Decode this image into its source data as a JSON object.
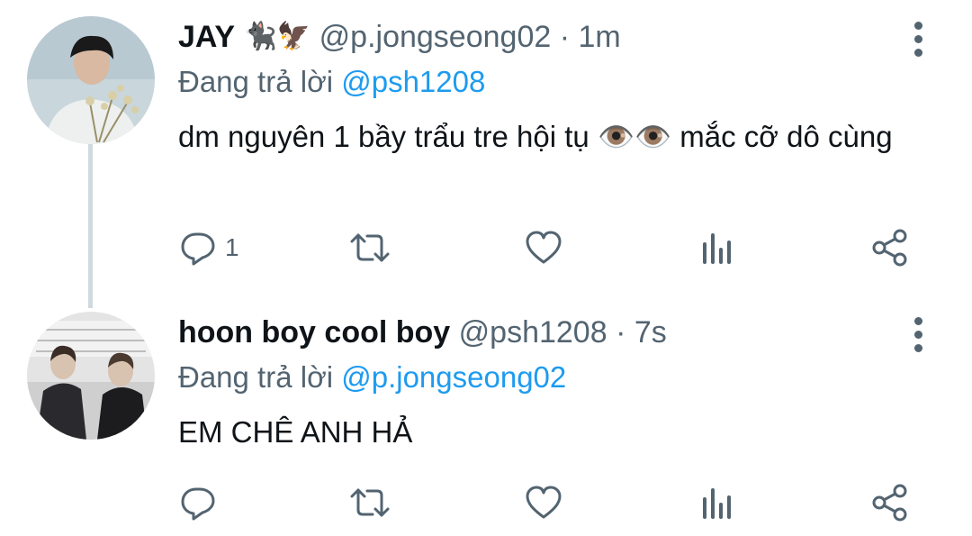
{
  "tweets": [
    {
      "name": "JAY",
      "name_emojis": "🐈‍⬛🦅",
      "handle": "@p.jongseong02",
      "separator": "·",
      "time": "1m",
      "replying_label": "Đang trả lời",
      "replying_to": "@psh1208",
      "text": "dm nguyên 1 bầy trẩu tre hội tụ 👁️👁️ mắc cỡ dô cùng",
      "reply_count": "1",
      "icons": [
        "reply-icon",
        "retweet-icon",
        "like-icon",
        "analytics-icon",
        "share-icon"
      ]
    },
    {
      "name": "hoon boy cool boy",
      "handle": "@psh1208",
      "separator": "·",
      "time": "7s",
      "replying_label": "Đang trả lời",
      "replying_to": "@p.jongseong02",
      "text": "EM CHÊ ANH HẢ",
      "reply_count": "",
      "icons": [
        "reply-icon",
        "retweet-icon",
        "like-icon",
        "analytics-icon",
        "share-icon"
      ]
    }
  ],
  "colors": {
    "accent": "#1d9bf0",
    "muted": "#536471",
    "text": "#0f1419",
    "thread_line": "#cfd9de"
  }
}
